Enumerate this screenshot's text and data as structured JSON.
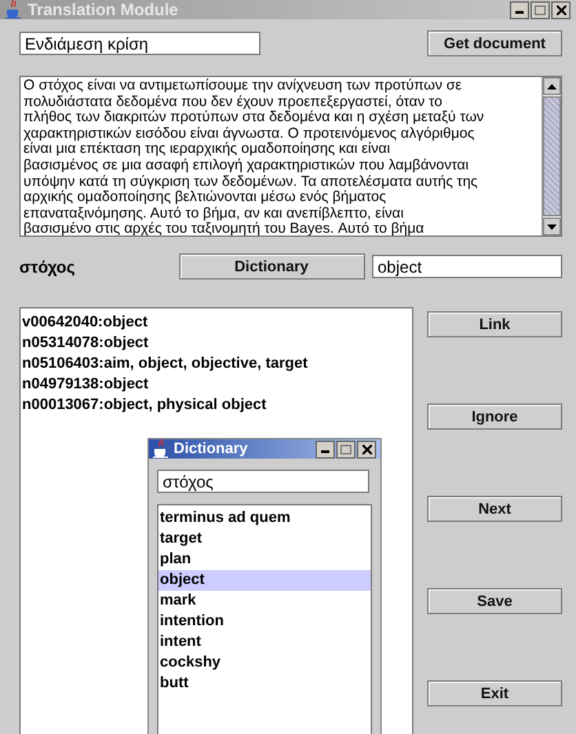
{
  "window": {
    "title": "Translation Module"
  },
  "document_field": {
    "value": "Ενδιάμεση κρίση"
  },
  "get_document_button": "Get document",
  "text_area": {
    "lines": [
      "Ο στόχος είναι να αντιμετωπίσουμε την ανίχνευση των προτύπων σε",
      "πολυδιάστατα δεδομένα που δεν έχουν προεπεξεργαστεί, όταν το",
      "πλήθος των διακριτών προτύπων στα δεδομένα και η σχέση μεταξύ των",
      "χαρακτηριστικών εισόδου είναι άγνωστα. Ο προτεινόμενος αλγόριθμος",
      "είναι μια επέκταση της ιεραρχικής ομαδοποίησης και είναι",
      "βασισμένος σε μια ασαφή επιλογή χαρακτηριστικών που λαμβάνονται",
      "υπόψην κατά τη σύγκριση των δεδομένων. Τα αποτελέσματα αυτής της",
      "αρχικής ομαδοποίησης βελτιώνονται μέσω ενός βήματος",
      "επαναταξινόμησης. Αυτό το βήμα, αν και ανεπίβλεπτο, είναι",
      "βασισμένο στις αρχές του ταξινομητή του Bayes. Αυτό το βήμα"
    ]
  },
  "word_label": "στόχος",
  "dictionary_button": "Dictionary",
  "translation_field": {
    "value": "object"
  },
  "senses": [
    {
      "text": "v00642040:object",
      "selected": false
    },
    {
      "text": "n05314078:object",
      "selected": false
    },
    {
      "text": "n05106403:aim, object, objective, target",
      "selected": false
    },
    {
      "text": "n04979138:object",
      "selected": false
    },
    {
      "text": "n00013067:object, physical object",
      "selected": false
    }
  ],
  "buttons": [
    "Link",
    "Ignore",
    "Next",
    "Save",
    "Exit"
  ],
  "dictionary_dialog": {
    "title": "Dictionary",
    "search_field": {
      "value": "στόχος"
    },
    "entries": [
      {
        "text": "terminus ad quem",
        "selected": false
      },
      {
        "text": "target",
        "selected": false
      },
      {
        "text": "plan",
        "selected": false
      },
      {
        "text": "object",
        "selected": true
      },
      {
        "text": "mark",
        "selected": false
      },
      {
        "text": "intention",
        "selected": false
      },
      {
        "text": "intent",
        "selected": false
      },
      {
        "text": "cockshy",
        "selected": false
      },
      {
        "text": "butt",
        "selected": false
      }
    ]
  }
}
